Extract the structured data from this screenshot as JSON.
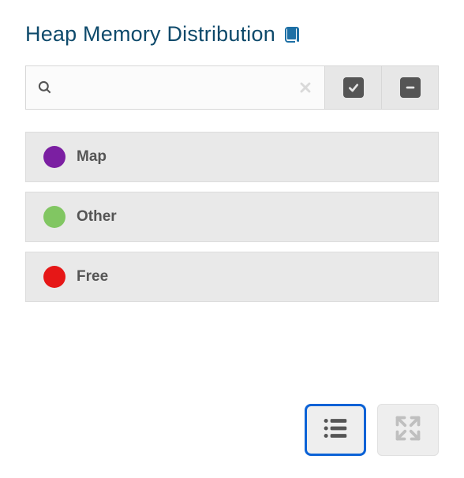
{
  "header": {
    "title": "Heap Memory Distribution"
  },
  "search": {
    "value": "",
    "placeholder": ""
  },
  "legend": {
    "items": [
      {
        "label": "Map",
        "color": "#7b1fa2"
      },
      {
        "label": "Other",
        "color": "#81c662"
      },
      {
        "label": "Free",
        "color": "#e61717"
      }
    ]
  }
}
